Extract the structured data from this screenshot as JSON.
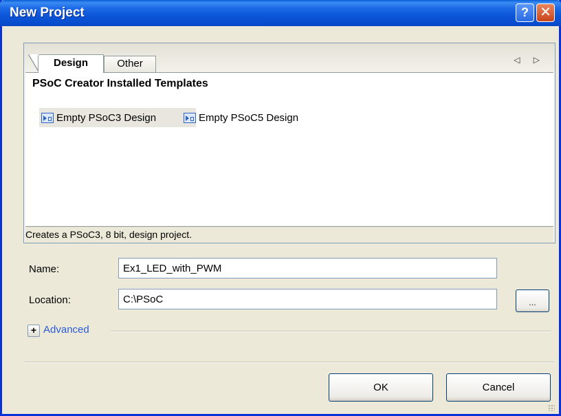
{
  "window": {
    "title": "New Project",
    "help_glyph": "?",
    "close_glyph": "✕"
  },
  "tabs": {
    "items": [
      {
        "label": "Design",
        "active": true
      },
      {
        "label": "Other",
        "active": false
      }
    ],
    "nav_arrows": "◁ ▷"
  },
  "templates": {
    "heading": "PSoC Creator Installed Templates",
    "items": [
      {
        "label": "Empty PSoC3 Design",
        "icon": "design-template-icon",
        "selected": true
      },
      {
        "label": "Empty PSoC5 Design",
        "icon": "design-template-icon",
        "selected": false
      }
    ],
    "description": "Creates a PSoC3, 8 bit, design project."
  },
  "form": {
    "name_label": "Name:",
    "name_value": "Ex1_LED_with_PWM",
    "location_label": "Location:",
    "location_value": "C:\\PSoC",
    "browse_label": "...",
    "advanced_toggle": "+",
    "advanced_label": "Advanced"
  },
  "buttons": {
    "ok": "OK",
    "cancel": "Cancel"
  },
  "colors": {
    "titlebar": "#0a5fd8",
    "dialog_bg": "#ece9d8",
    "link_blue": "#2a5bd7",
    "close_button": "#c9441a"
  }
}
